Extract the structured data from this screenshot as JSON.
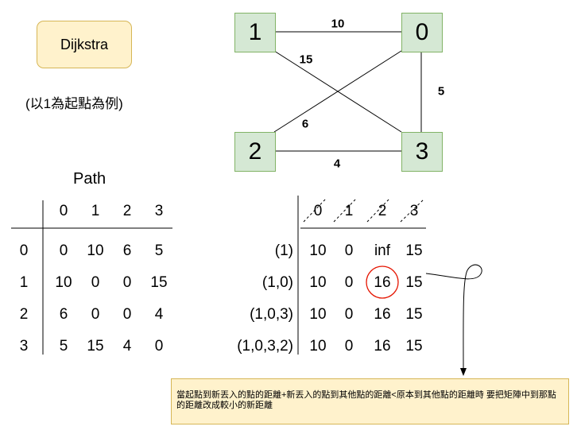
{
  "title": "Dijkstra",
  "subtitle": "(以1為起點為例)",
  "graph": {
    "nodes": [
      "1",
      "0",
      "2",
      "3"
    ],
    "edges": [
      {
        "from": "1",
        "to": "0",
        "label": "10"
      },
      {
        "from": "1",
        "to": "3",
        "label": "15"
      },
      {
        "from": "0",
        "to": "3",
        "label": "5"
      },
      {
        "from": "2",
        "to": "0",
        "label": "6"
      },
      {
        "from": "2",
        "to": "3",
        "label": "4"
      }
    ]
  },
  "path_table": {
    "title": "Path",
    "col_headers": [
      "0",
      "1",
      "2",
      "3"
    ],
    "row_headers": [
      "0",
      "1",
      "2",
      "3"
    ],
    "rows": [
      [
        "0",
        "10",
        "6",
        "5"
      ],
      [
        "10",
        "0",
        "0",
        "15"
      ],
      [
        "6",
        "0",
        "0",
        "4"
      ],
      [
        "5",
        "15",
        "4",
        "0"
      ]
    ]
  },
  "dist_table": {
    "col_headers": [
      "0",
      "1",
      "2",
      "3"
    ],
    "row_headers": [
      "(1)",
      "(1,0)",
      "(1,0,3)",
      "(1,0,3,2)"
    ],
    "rows": [
      [
        "10",
        "0",
        "inf",
        "15"
      ],
      [
        "10",
        "0",
        "16",
        "15"
      ],
      [
        "10",
        "0",
        "16",
        "15"
      ],
      [
        "10",
        "0",
        "16",
        "15"
      ]
    ],
    "highlight": {
      "row": 1,
      "col": 2,
      "color": "#e51400"
    }
  },
  "note": "當起點到新丟入的點的距離+新丟入的點到其他點的距離<原本到其他點的距離時 要把矩陣中到那點的距離改成較小的新距離",
  "colors": {
    "node_fill": "#d5e8d4",
    "node_border": "#82b366",
    "note_fill": "#fff2cc",
    "note_border": "#d6b656",
    "highlight": "#e51400"
  }
}
